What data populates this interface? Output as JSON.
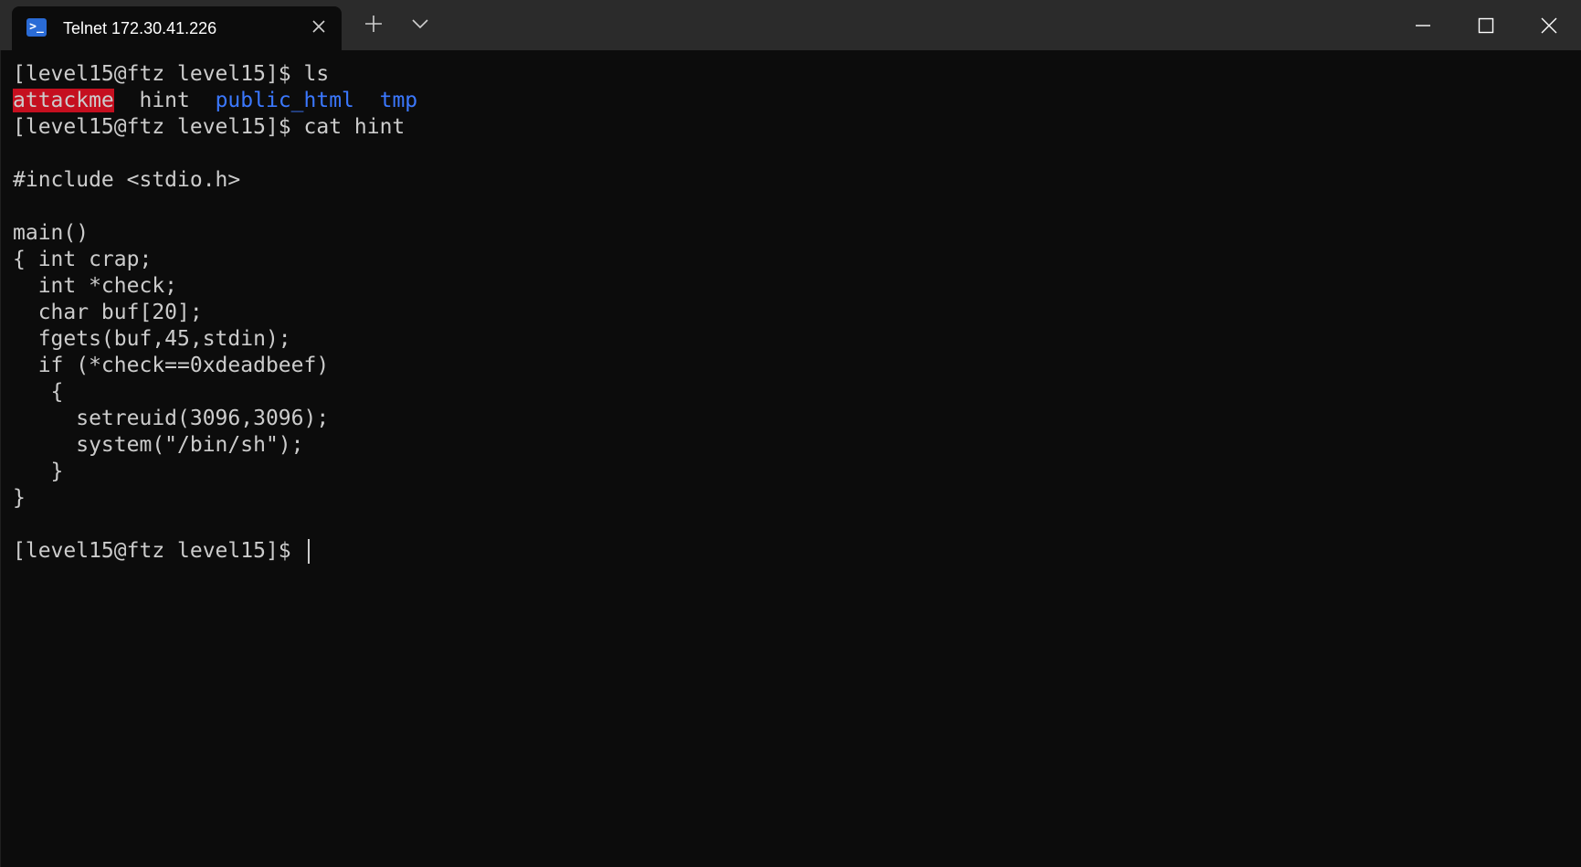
{
  "tab": {
    "icon": "powershell-icon",
    "title": "Telnet 172.30.41.226"
  },
  "titlebar": {
    "new_tab_icon": "plus-icon",
    "dropdown_icon": "chevron-down-icon",
    "minimize_icon": "minimize-icon",
    "maximize_icon": "maximize-icon",
    "close_icon": "close-icon"
  },
  "colors": {
    "terminal_bg": "#0c0c0c",
    "titlebar_bg": "#2b2b2b",
    "text": "#cccccc",
    "executable_bg": "#c50f1f",
    "directory": "#3b78ff"
  },
  "terminal": {
    "prompt": "[level15@ftz level15]$",
    "cmd1": "ls",
    "ls_output": {
      "executable": "attackme",
      "file": "hint",
      "dir1": "public_html",
      "dir2": "tmp"
    },
    "cmd2": "cat hint",
    "code": [
      "#include <stdio.h>",
      "main()",
      "{ int crap;",
      "  int *check;",
      "  char buf[20];",
      "  fgets(buf,45,stdin);",
      "  if (*check==0xdeadbeef)",
      "   {",
      "     setreuid(3096,3096);",
      "     system(\"/bin/sh\");",
      "   }",
      "}"
    ]
  }
}
